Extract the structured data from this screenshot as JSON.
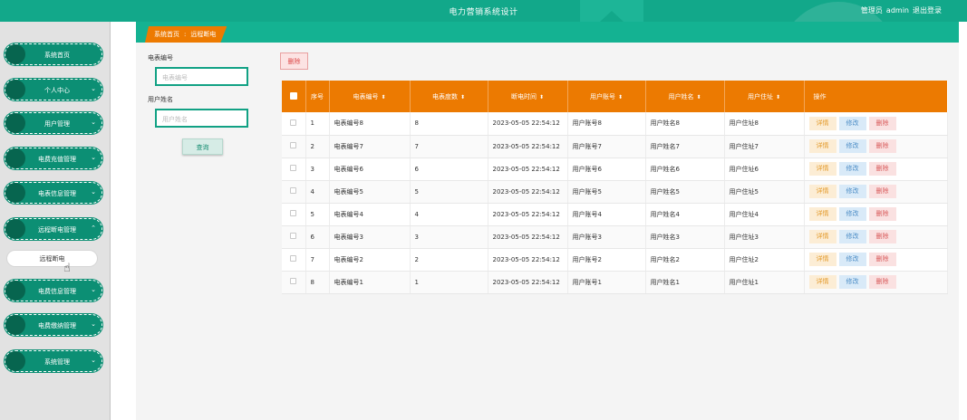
{
  "header": {
    "title": "电力营销系统设计",
    "role": "管理员",
    "username": "admin",
    "logout": "退出登录"
  },
  "sidebar": {
    "items": [
      {
        "label": "系统首页",
        "chevron": ""
      },
      {
        "label": "个人中心",
        "chevron": "⌄"
      },
      {
        "label": "用户管理",
        "chevron": "⌄"
      },
      {
        "label": "电费充值管理",
        "chevron": "⌄"
      },
      {
        "label": "电表信息管理",
        "chevron": "⌄"
      },
      {
        "label": "远程断电管理",
        "chevron": "⌃"
      },
      {
        "label": "电费信息管理",
        "chevron": "⌄"
      },
      {
        "label": "电费缴纳管理",
        "chevron": "⌄"
      },
      {
        "label": "系统管理",
        "chevron": "⌄"
      }
    ],
    "active_sub": "远程断电"
  },
  "breadcrumb": {
    "home": "系统首页",
    "separator": ":",
    "current": "远程断电"
  },
  "search": {
    "meter_label": "电表编号",
    "meter_placeholder": "电表编号",
    "name_label": "用户姓名",
    "name_placeholder": "用户姓名",
    "button": "查询"
  },
  "toolbar": {
    "delete": "删除"
  },
  "table": {
    "columns": [
      "序号",
      "电表编号",
      "电表度数",
      "断电时间",
      "用户账号",
      "用户姓名",
      "用户住址",
      "操作"
    ],
    "sort_icon": "⬍",
    "rows": [
      {
        "no": "1",
        "meter": "电表编号8",
        "reading": "8",
        "time": "2023-05-05 22:54:12",
        "account": "用户账号8",
        "name": "用户姓名8",
        "address": "用户住址8"
      },
      {
        "no": "2",
        "meter": "电表编号7",
        "reading": "7",
        "time": "2023-05-05 22:54:12",
        "account": "用户账号7",
        "name": "用户姓名7",
        "address": "用户住址7"
      },
      {
        "no": "3",
        "meter": "电表编号6",
        "reading": "6",
        "time": "2023-05-05 22:54:12",
        "account": "用户账号6",
        "name": "用户姓名6",
        "address": "用户住址6"
      },
      {
        "no": "4",
        "meter": "电表编号5",
        "reading": "5",
        "time": "2023-05-05 22:54:12",
        "account": "用户账号5",
        "name": "用户姓名5",
        "address": "用户住址5"
      },
      {
        "no": "5",
        "meter": "电表编号4",
        "reading": "4",
        "time": "2023-05-05 22:54:12",
        "account": "用户账号4",
        "name": "用户姓名4",
        "address": "用户住址4"
      },
      {
        "no": "6",
        "meter": "电表编号3",
        "reading": "3",
        "time": "2023-05-05 22:54:12",
        "account": "用户账号3",
        "name": "用户姓名3",
        "address": "用户住址3"
      },
      {
        "no": "7",
        "meter": "电表编号2",
        "reading": "2",
        "time": "2023-05-05 22:54:12",
        "account": "用户账号2",
        "name": "用户姓名2",
        "address": "用户住址2"
      },
      {
        "no": "8",
        "meter": "电表编号1",
        "reading": "1",
        "time": "2023-05-05 22:54:12",
        "account": "用户账号1",
        "name": "用户姓名1",
        "address": "用户住址1"
      }
    ],
    "actions": {
      "detail": "详情",
      "edit": "修改",
      "delete": "删除"
    }
  },
  "colors": {
    "primary": "#12a88a",
    "accent": "#ec7a01",
    "sidebar_item": "#0c8f74"
  },
  "icons": {
    "cursor": "hand-pointer-icon",
    "sort": "sort-icon",
    "chevron": "chevron-icon"
  }
}
